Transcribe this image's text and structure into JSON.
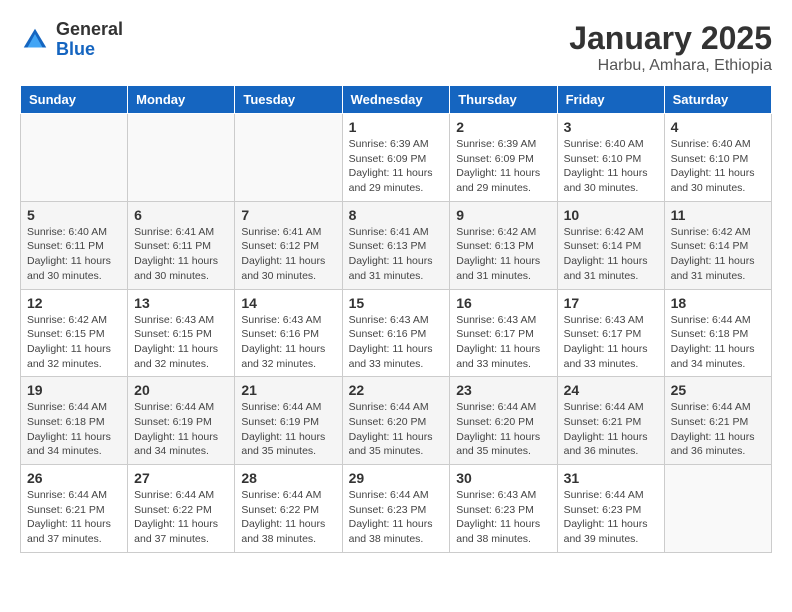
{
  "logo": {
    "general": "General",
    "blue": "Blue"
  },
  "title": "January 2025",
  "location": "Harbu, Amhara, Ethiopia",
  "days_of_week": [
    "Sunday",
    "Monday",
    "Tuesday",
    "Wednesday",
    "Thursday",
    "Friday",
    "Saturday"
  ],
  "weeks": [
    [
      {
        "day": "",
        "info": ""
      },
      {
        "day": "",
        "info": ""
      },
      {
        "day": "",
        "info": ""
      },
      {
        "day": "1",
        "info": "Sunrise: 6:39 AM\nSunset: 6:09 PM\nDaylight: 11 hours and 29 minutes."
      },
      {
        "day": "2",
        "info": "Sunrise: 6:39 AM\nSunset: 6:09 PM\nDaylight: 11 hours and 29 minutes."
      },
      {
        "day": "3",
        "info": "Sunrise: 6:40 AM\nSunset: 6:10 PM\nDaylight: 11 hours and 30 minutes."
      },
      {
        "day": "4",
        "info": "Sunrise: 6:40 AM\nSunset: 6:10 PM\nDaylight: 11 hours and 30 minutes."
      }
    ],
    [
      {
        "day": "5",
        "info": "Sunrise: 6:40 AM\nSunset: 6:11 PM\nDaylight: 11 hours and 30 minutes."
      },
      {
        "day": "6",
        "info": "Sunrise: 6:41 AM\nSunset: 6:11 PM\nDaylight: 11 hours and 30 minutes."
      },
      {
        "day": "7",
        "info": "Sunrise: 6:41 AM\nSunset: 6:12 PM\nDaylight: 11 hours and 30 minutes."
      },
      {
        "day": "8",
        "info": "Sunrise: 6:41 AM\nSunset: 6:13 PM\nDaylight: 11 hours and 31 minutes."
      },
      {
        "day": "9",
        "info": "Sunrise: 6:42 AM\nSunset: 6:13 PM\nDaylight: 11 hours and 31 minutes."
      },
      {
        "day": "10",
        "info": "Sunrise: 6:42 AM\nSunset: 6:14 PM\nDaylight: 11 hours and 31 minutes."
      },
      {
        "day": "11",
        "info": "Sunrise: 6:42 AM\nSunset: 6:14 PM\nDaylight: 11 hours and 31 minutes."
      }
    ],
    [
      {
        "day": "12",
        "info": "Sunrise: 6:42 AM\nSunset: 6:15 PM\nDaylight: 11 hours and 32 minutes."
      },
      {
        "day": "13",
        "info": "Sunrise: 6:43 AM\nSunset: 6:15 PM\nDaylight: 11 hours and 32 minutes."
      },
      {
        "day": "14",
        "info": "Sunrise: 6:43 AM\nSunset: 6:16 PM\nDaylight: 11 hours and 32 minutes."
      },
      {
        "day": "15",
        "info": "Sunrise: 6:43 AM\nSunset: 6:16 PM\nDaylight: 11 hours and 33 minutes."
      },
      {
        "day": "16",
        "info": "Sunrise: 6:43 AM\nSunset: 6:17 PM\nDaylight: 11 hours and 33 minutes."
      },
      {
        "day": "17",
        "info": "Sunrise: 6:43 AM\nSunset: 6:17 PM\nDaylight: 11 hours and 33 minutes."
      },
      {
        "day": "18",
        "info": "Sunrise: 6:44 AM\nSunset: 6:18 PM\nDaylight: 11 hours and 34 minutes."
      }
    ],
    [
      {
        "day": "19",
        "info": "Sunrise: 6:44 AM\nSunset: 6:18 PM\nDaylight: 11 hours and 34 minutes."
      },
      {
        "day": "20",
        "info": "Sunrise: 6:44 AM\nSunset: 6:19 PM\nDaylight: 11 hours and 34 minutes."
      },
      {
        "day": "21",
        "info": "Sunrise: 6:44 AM\nSunset: 6:19 PM\nDaylight: 11 hours and 35 minutes."
      },
      {
        "day": "22",
        "info": "Sunrise: 6:44 AM\nSunset: 6:20 PM\nDaylight: 11 hours and 35 minutes."
      },
      {
        "day": "23",
        "info": "Sunrise: 6:44 AM\nSunset: 6:20 PM\nDaylight: 11 hours and 35 minutes."
      },
      {
        "day": "24",
        "info": "Sunrise: 6:44 AM\nSunset: 6:21 PM\nDaylight: 11 hours and 36 minutes."
      },
      {
        "day": "25",
        "info": "Sunrise: 6:44 AM\nSunset: 6:21 PM\nDaylight: 11 hours and 36 minutes."
      }
    ],
    [
      {
        "day": "26",
        "info": "Sunrise: 6:44 AM\nSunset: 6:21 PM\nDaylight: 11 hours and 37 minutes."
      },
      {
        "day": "27",
        "info": "Sunrise: 6:44 AM\nSunset: 6:22 PM\nDaylight: 11 hours and 37 minutes."
      },
      {
        "day": "28",
        "info": "Sunrise: 6:44 AM\nSunset: 6:22 PM\nDaylight: 11 hours and 38 minutes."
      },
      {
        "day": "29",
        "info": "Sunrise: 6:44 AM\nSunset: 6:23 PM\nDaylight: 11 hours and 38 minutes."
      },
      {
        "day": "30",
        "info": "Sunrise: 6:43 AM\nSunset: 6:23 PM\nDaylight: 11 hours and 38 minutes."
      },
      {
        "day": "31",
        "info": "Sunrise: 6:44 AM\nSunset: 6:23 PM\nDaylight: 11 hours and 39 minutes."
      },
      {
        "day": "",
        "info": ""
      }
    ]
  ]
}
